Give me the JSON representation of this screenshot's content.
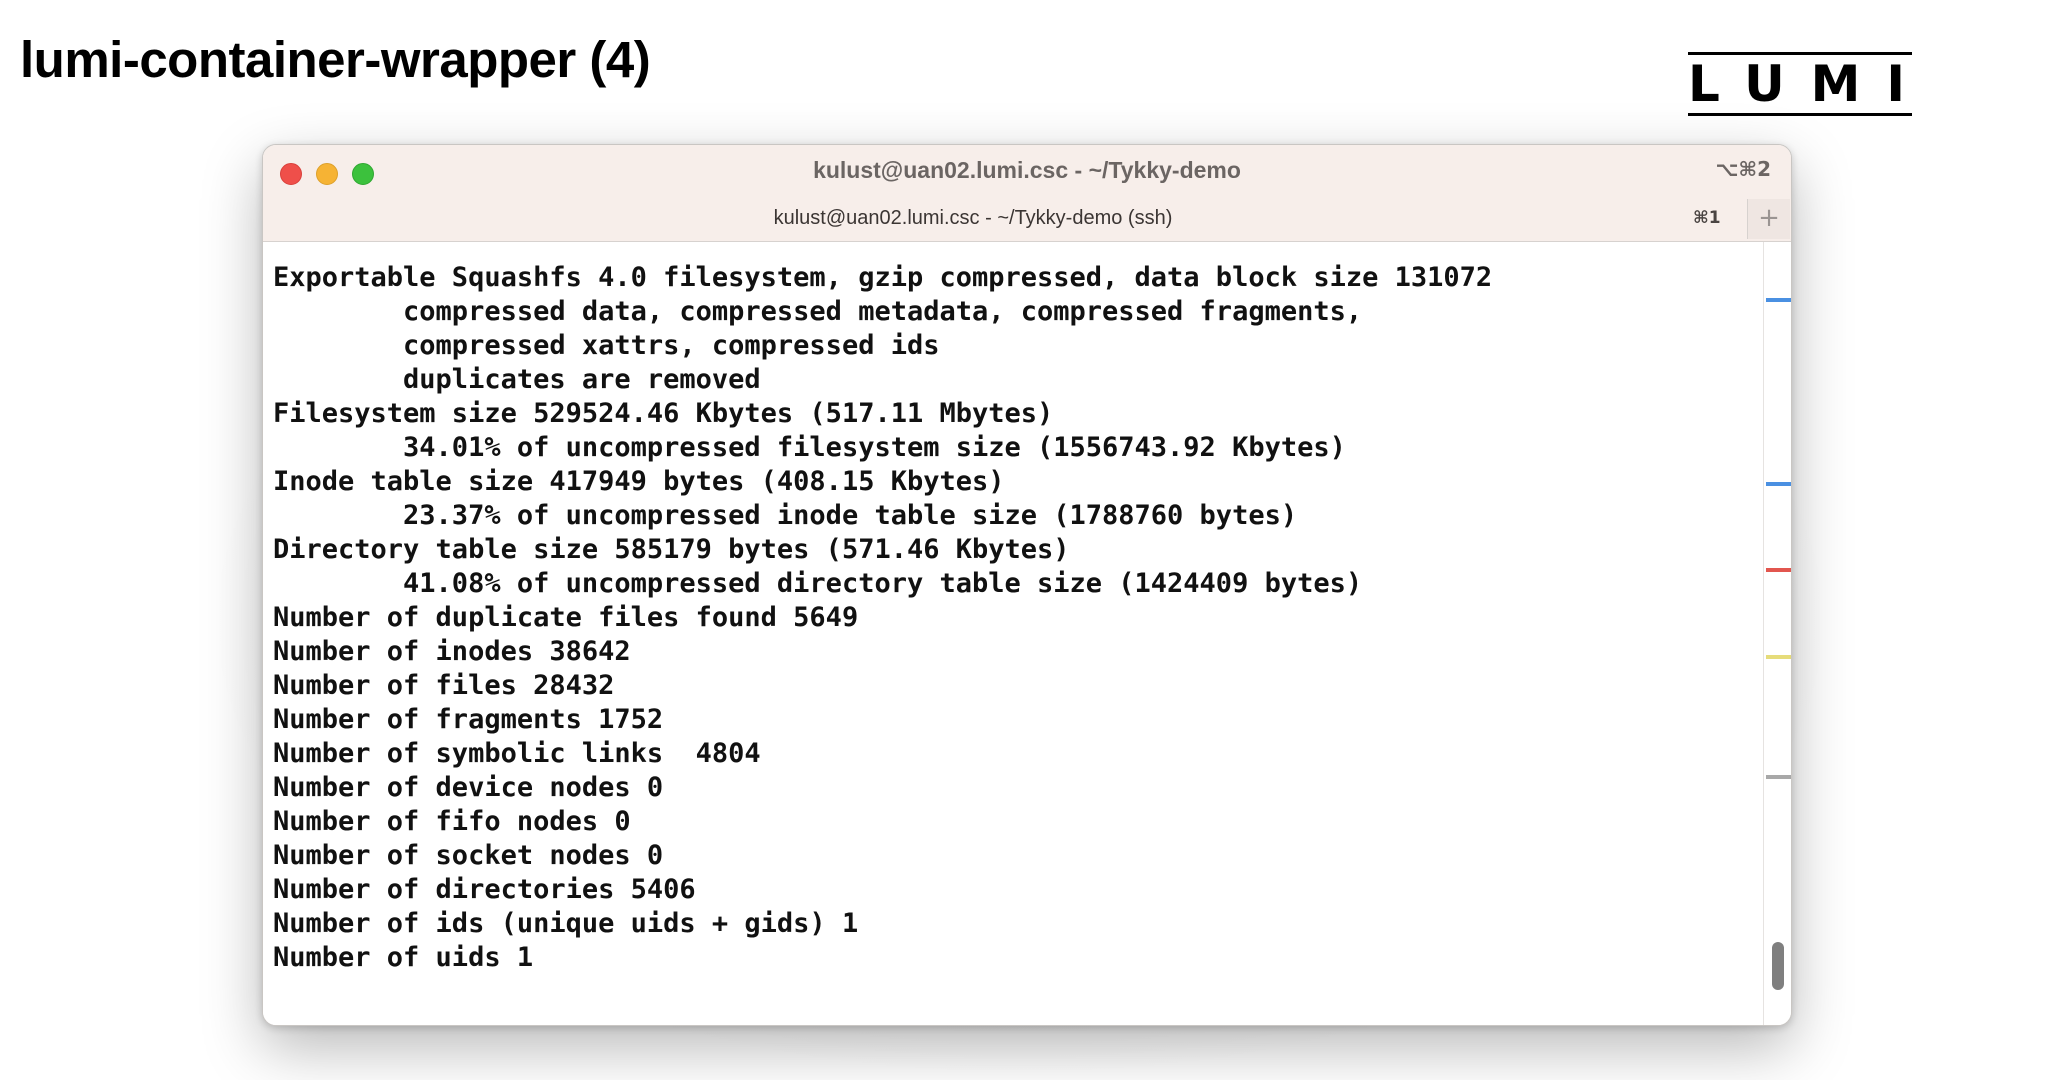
{
  "slide": {
    "title": "lumi-container-wrapper (4)",
    "logo_text": "LUMI"
  },
  "window": {
    "title": "kulust@uan02.lumi.csc - ~/Tykky-demo",
    "shortcut": "⌥⌘2",
    "traffic_lights": [
      "close",
      "minimize",
      "zoom"
    ],
    "tab": {
      "title": "kulust@uan02.lumi.csc - ~/Tykky-demo (ssh)",
      "shortcut": "⌘1",
      "new_tab_label": "+"
    }
  },
  "terminal": {
    "lines": [
      "Exportable Squashfs 4.0 filesystem, gzip compressed, data block size 131072",
      "        compressed data, compressed metadata, compressed fragments,",
      "        compressed xattrs, compressed ids",
      "        duplicates are removed",
      "Filesystem size 529524.46 Kbytes (517.11 Mbytes)",
      "        34.01% of uncompressed filesystem size (1556743.92 Kbytes)",
      "Inode table size 417949 bytes (408.15 Kbytes)",
      "        23.37% of uncompressed inode table size (1788760 bytes)",
      "Directory table size 585179 bytes (571.46 Kbytes)",
      "        41.08% of uncompressed directory table size (1424409 bytes)",
      "Number of duplicate files found 5649",
      "Number of inodes 38642",
      "Number of files 28432",
      "Number of fragments 1752",
      "Number of symbolic links  4804",
      "Number of device nodes 0",
      "Number of fifo nodes 0",
      "Number of socket nodes 0",
      "Number of directories 5406",
      "Number of ids (unique uids + gids) 1",
      "Number of uids 1"
    ]
  },
  "scrollbar": {
    "mark_colors": [
      "#4a90e2",
      "#4a90e2",
      "#e2564f",
      "#e6dc7a",
      "#a8a8a8"
    ]
  }
}
